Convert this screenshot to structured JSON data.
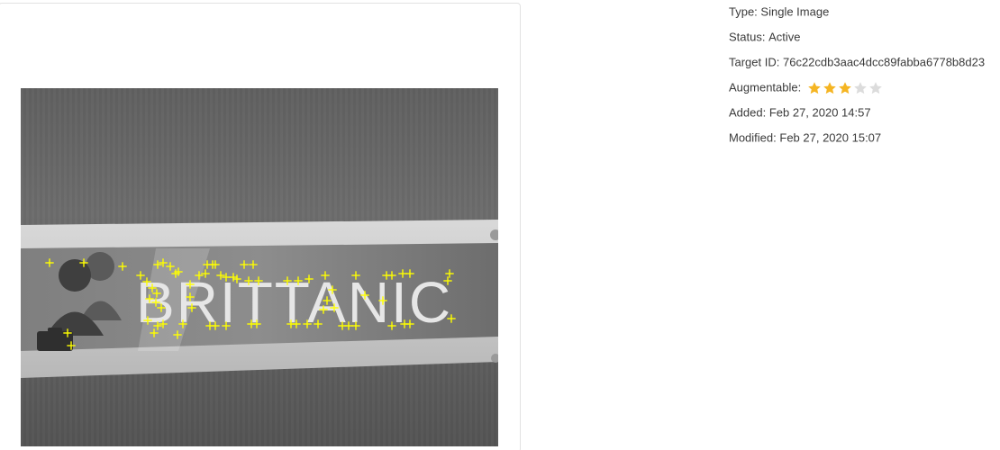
{
  "target": {
    "image_text": "BRITTANIC",
    "image_alt": "BRITTANIC",
    "feature_color": "#ffff00"
  },
  "details": {
    "type_label": "Type:",
    "type_value": "Single Image",
    "status_label": "Status:",
    "status_value": "Active",
    "target_id_label": "Target ID:",
    "target_id_value": "76c22cdb3aac4dcc89fabba6778b8d23",
    "augmentable_label": "Augmentable:",
    "augmentable_rating": 3,
    "augmentable_max": 5,
    "added_label": "Added:",
    "added_value": "Feb 27, 2020 14:57",
    "modified_label": "Modified:",
    "modified_value": "Feb 27, 2020 15:07"
  },
  "colors": {
    "star_filled": "#f5b523",
    "star_empty": "#dcdcdc"
  }
}
